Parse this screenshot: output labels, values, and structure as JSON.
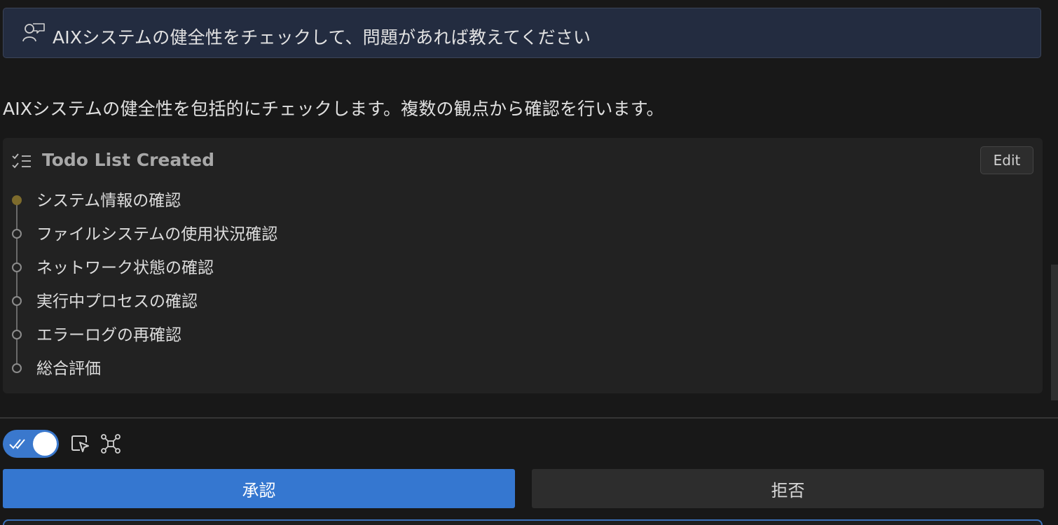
{
  "user_message": {
    "icon": "user-feedback-icon",
    "text": "AIXシステムの健全性をチェックして、問題があれば教えてください"
  },
  "assistant_message": {
    "text": "AIXシステムの健全性を包括的にチェックします。複数の観点から確認を行います。"
  },
  "todo": {
    "title_icon": "checklist-icon",
    "title": "Todo List Created",
    "edit_label": "Edit",
    "items": [
      {
        "label": "システム情報の確認",
        "status": "in-progress"
      },
      {
        "label": "ファイルシステムの使用状況確認",
        "status": "pending"
      },
      {
        "label": "ネットワーク状態の確認",
        "status": "pending"
      },
      {
        "label": "実行中プロセスの確認",
        "status": "pending"
      },
      {
        "label": "エラーログの再確認",
        "status": "pending"
      },
      {
        "label": "総合評価",
        "status": "pending"
      }
    ]
  },
  "toolbar": {
    "auto_approve_toggle": {
      "on": true,
      "icon": "double-check-icon"
    },
    "icons": [
      "cursor-select-icon",
      "network-nodes-icon"
    ]
  },
  "actions": {
    "approve_label": "承認",
    "reject_label": "拒否"
  },
  "colors": {
    "accent": "#3577d0",
    "active_dot": "#7d6b2c",
    "user_bubble": "#232c40"
  }
}
